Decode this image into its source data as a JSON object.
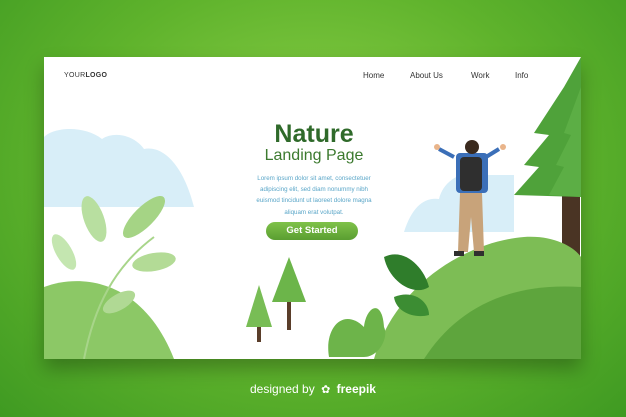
{
  "logo": {
    "part1": "YOUR",
    "part2": "LOGO"
  },
  "nav": {
    "items": [
      "Home",
      "About Us",
      "Work",
      "Info"
    ]
  },
  "hero": {
    "title": "Nature",
    "subtitle": "Landing Page",
    "body_lines": [
      "Lorem ipsum dolor sit amet, consectetuer",
      "adipiscing elit, sed diam nonummy nibh",
      "euismod tincidunt ut laoreet dolore magna",
      "aliquam erat volutpat."
    ],
    "cta_label": "Get Started"
  },
  "credit": {
    "prefix": "designed by",
    "brand": "freepik"
  },
  "colors": {
    "background_green": "#5fb32c",
    "title_green": "#2f6a2a",
    "body_blue": "#5aa6c8",
    "cta_green": "#6aaf3b"
  },
  "icons": [
    "freepik-logo-icon"
  ]
}
